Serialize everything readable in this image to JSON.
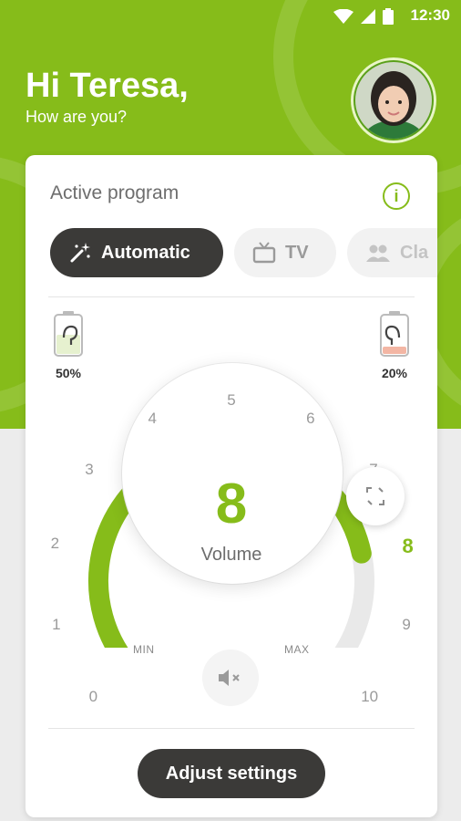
{
  "status_bar": {
    "time": "12:30"
  },
  "greeting": {
    "title": "Hi Teresa,",
    "subtitle": "How are you?"
  },
  "active_program": {
    "title": "Active program",
    "info_icon_label": "i",
    "tabs": [
      {
        "label": "Automatic",
        "icon": "magic-wand-icon",
        "selected": true
      },
      {
        "label": "TV",
        "icon": "tv-icon",
        "selected": false
      },
      {
        "label": "Cla",
        "icon": "people-icon",
        "selected": false
      }
    ]
  },
  "batteries": {
    "left": {
      "percent_label": "50%",
      "level": 0.5,
      "color": "#e6f1cf"
    },
    "right": {
      "percent_label": "20%",
      "level": 0.2,
      "color": "#f3b6a4"
    }
  },
  "volume": {
    "value": "8",
    "label": "Volume",
    "level": 8,
    "max": 10,
    "ticks": [
      "0",
      "1",
      "2",
      "3",
      "4",
      "5",
      "6",
      "7",
      "8",
      "9",
      "10"
    ],
    "min_label": "MIN",
    "max_label": "MAX"
  },
  "colors": {
    "accent": "#86bc1a",
    "dark": "#3b3a38"
  },
  "adjust_button": {
    "label": "Adjust settings"
  }
}
